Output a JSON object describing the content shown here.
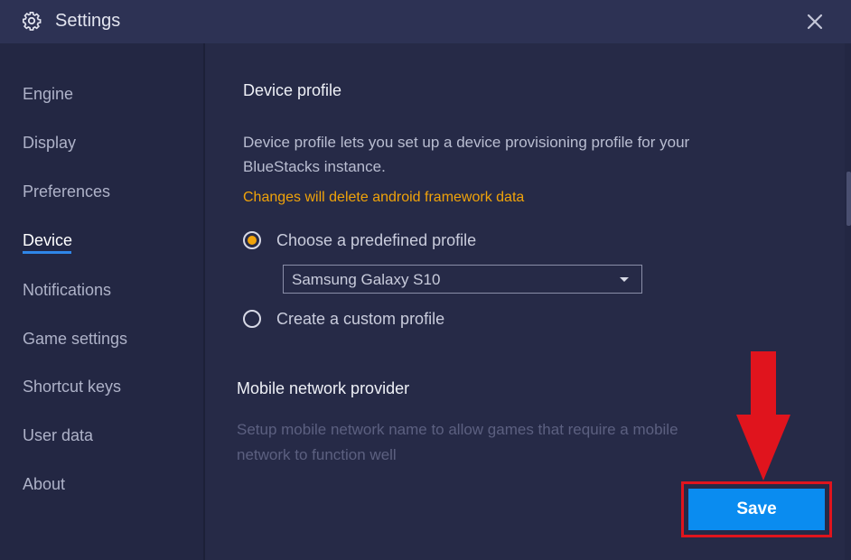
{
  "window": {
    "title": "Settings",
    "icon": "gear-icon",
    "close_icon": "close-icon"
  },
  "sidebar": {
    "items": [
      {
        "label": "Engine",
        "active": false
      },
      {
        "label": "Display",
        "active": false
      },
      {
        "label": "Preferences",
        "active": false
      },
      {
        "label": "Device",
        "active": true
      },
      {
        "label": "Notifications",
        "active": false
      },
      {
        "label": "Game settings",
        "active": false
      },
      {
        "label": "Shortcut keys",
        "active": false
      },
      {
        "label": "User data",
        "active": false
      },
      {
        "label": "About",
        "active": false
      }
    ]
  },
  "device_profile": {
    "title": "Device profile",
    "description_line1": "Device profile lets you set up a device provisioning profile for your",
    "description_line2": "BlueStacks instance.",
    "warning": "Changes will delete android framework data",
    "option_predefined": "Choose a predefined profile",
    "option_predefined_selected": true,
    "selected_profile": "Samsung Galaxy S10",
    "option_custom": "Create a custom profile",
    "option_custom_selected": false
  },
  "network": {
    "title": "Mobile network provider",
    "description_line1": "Setup mobile network name to allow games that require a mobile",
    "description_line2": "network to function well"
  },
  "footer": {
    "save_label": "Save"
  },
  "colors": {
    "accent": "#0a8cf0",
    "warning": "#f0a30a",
    "highlight": "#e0141d",
    "active_underline": "#2f86e8"
  }
}
